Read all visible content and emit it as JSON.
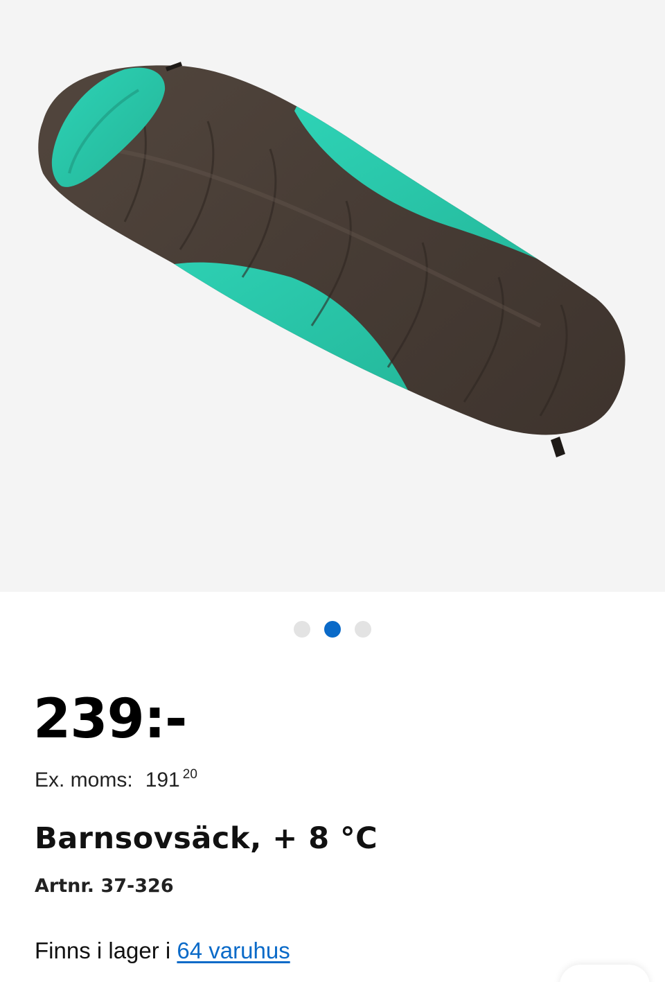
{
  "product": {
    "image_alt": "Barnsovsäck",
    "carousel": {
      "total": 3,
      "active_index": 2
    },
    "price": "239:-",
    "ex_vat": {
      "label": "Ex. moms:",
      "whole": "191",
      "decimals": "20"
    },
    "title": "Barnsovsäck, + 8 °C",
    "article_number": "Artnr. 37-326",
    "stock": {
      "prefix": "Finns i lager i ",
      "link_text": "64 varuhus"
    }
  },
  "colors": {
    "accent_link": "#0a6ac8",
    "bag_brown": "#4a3f38",
    "bag_teal": "#2fc1a6"
  }
}
